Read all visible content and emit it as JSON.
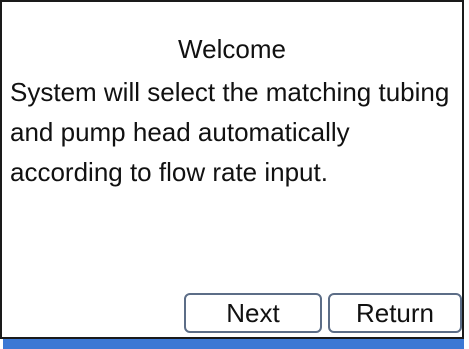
{
  "dialog": {
    "title": "Welcome",
    "message": "System will select the matching tubing and pump head automatically according to flow rate input."
  },
  "buttons": {
    "next_label": "Next",
    "return_label": "Return"
  },
  "colors": {
    "border": "#1a1a1a",
    "button_border": "#5c6d87",
    "accent_bar": "#3b78d4",
    "background": "#ffffff"
  }
}
